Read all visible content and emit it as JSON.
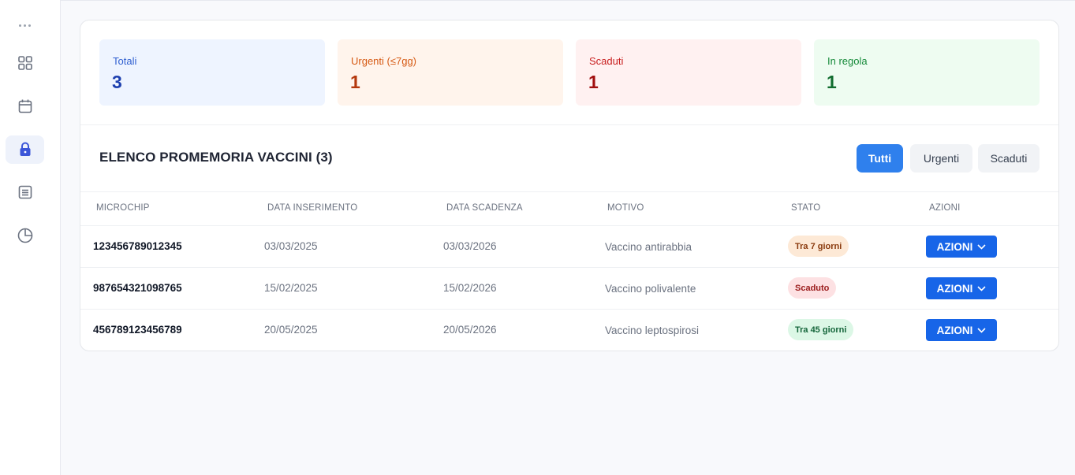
{
  "stats": [
    {
      "label": "Totali",
      "value": "3"
    },
    {
      "label": "Urgenti (≤7gg)",
      "value": "1"
    },
    {
      "label": "Scaduti",
      "value": "1"
    },
    {
      "label": "In regola",
      "value": "1"
    }
  ],
  "list": {
    "title": "ELENCO PROMEMORIA VACCINI (3)",
    "filters": [
      "Tutti",
      "Urgenti",
      "Scaduti"
    ],
    "columns": [
      "MICROCHIP",
      "DATA INSERIMENTO",
      "DATA SCADENZA",
      "MOTIVO",
      "STATO",
      "AZIONI"
    ],
    "rows": [
      {
        "microchip": "123456789012345",
        "inserted": "03/03/2025",
        "expiry": "03/03/2026",
        "reason": "Vaccino antirabbia",
        "status": "Tra 7 giorni",
        "action": "AZIONI"
      },
      {
        "microchip": "987654321098765",
        "inserted": "15/02/2025",
        "expiry": "15/02/2026",
        "reason": "Vaccino polivalente",
        "status": "Scaduto",
        "action": "AZIONI"
      },
      {
        "microchip": "456789123456789",
        "inserted": "20/05/2025",
        "expiry": "20/05/2026",
        "reason": "Vaccino leptospirosi",
        "status": "Tra 45 giorni",
        "action": "AZIONI"
      }
    ]
  },
  "sidebar": {
    "icons": [
      "more-icon",
      "dashboard-grid-icon",
      "calendar-icon",
      "lock-icon",
      "document-list-icon",
      "pie-chart-icon"
    ],
    "active": "lock-icon"
  },
  "colors": {
    "primary": "#2f80ed",
    "action": "#1765e8",
    "urgent": "#d65a14",
    "expired": "#c81e1e",
    "ok": "#168a3a"
  }
}
